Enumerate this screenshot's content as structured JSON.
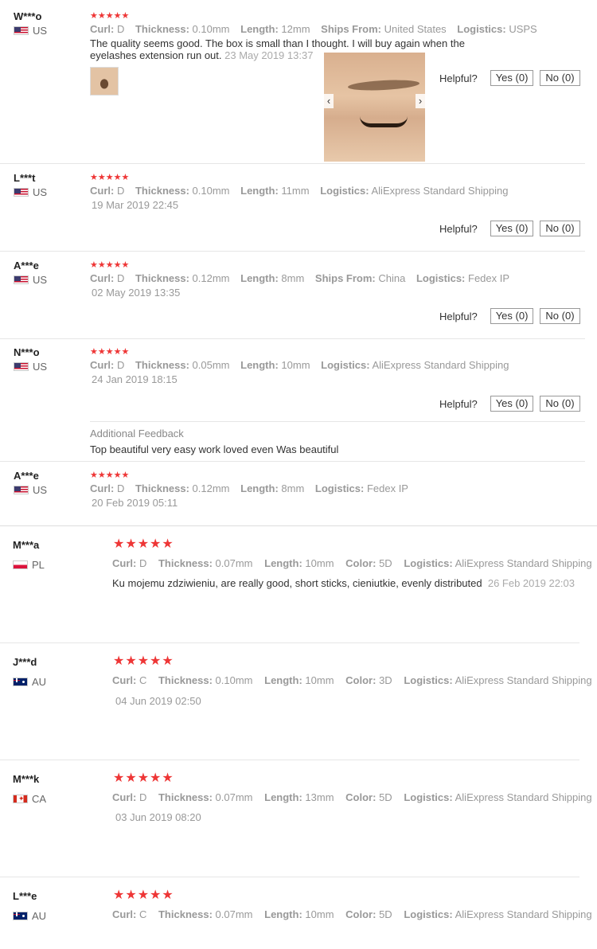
{
  "helpful_label": "Helpful?",
  "additional_feedback_label": "Additional Feedback",
  "reviews": [
    {
      "user": "W***o",
      "country": "US",
      "attrs": {
        "curl_k": "Curl:",
        "curl": "D",
        "thick_k": "Thickness:",
        "thick": "0.10mm",
        "len_k": "Length:",
        "len": "12mm",
        "ships_k": "Ships From:",
        "ships": "United States",
        "log_k": "Logistics:",
        "log": "USPS"
      },
      "text": "The quality seems good. The box is small than I thought. I will buy again when the eyelashes extension run out.",
      "date": "23 May 2019 13:37",
      "yes": "Yes (0)",
      "no": "No (0)"
    },
    {
      "user": "L***t",
      "country": "US",
      "attrs": {
        "curl_k": "Curl:",
        "curl": "D",
        "thick_k": "Thickness:",
        "thick": "0.10mm",
        "len_k": "Length:",
        "len": "11mm",
        "log_k": "Logistics:",
        "log": "AliExpress Standard Shipping"
      },
      "date": "19 Mar 2019 22:45",
      "yes": "Yes (0)",
      "no": "No (0)"
    },
    {
      "user": "A***e",
      "country": "US",
      "attrs": {
        "curl_k": "Curl:",
        "curl": "D",
        "thick_k": "Thickness:",
        "thick": "0.12mm",
        "len_k": "Length:",
        "len": "8mm",
        "ships_k": "Ships From:",
        "ships": "China",
        "log_k": "Logistics:",
        "log": "Fedex IP"
      },
      "date": "02 May 2019 13:35",
      "yes": "Yes (0)",
      "no": "No (0)"
    },
    {
      "user": "N***o",
      "country": "US",
      "attrs": {
        "curl_k": "Curl:",
        "curl": "D",
        "thick_k": "Thickness:",
        "thick": "0.05mm",
        "len_k": "Length:",
        "len": "10mm",
        "log_k": "Logistics:",
        "log": "AliExpress Standard Shipping"
      },
      "date": "24 Jan 2019 18:15",
      "yes": "Yes (0)",
      "no": "No (0)",
      "additional": "Top beautiful very easy work loved even Was beautiful"
    },
    {
      "user": "A***e",
      "country": "US",
      "attrs": {
        "curl_k": "Curl:",
        "curl": "D",
        "thick_k": "Thickness:",
        "thick": "0.12mm",
        "len_k": "Length:",
        "len": "8mm",
        "log_k": "Logistics:",
        "log": "Fedex IP"
      },
      "date": "20 Feb 2019 05:11"
    },
    {
      "user": "M***a",
      "country": "PL",
      "attrs": {
        "curl_k": "Curl:",
        "curl": "D",
        "thick_k": "Thickness:",
        "thick": "0.07mm",
        "len_k": "Length:",
        "len": "10mm",
        "color_k": "Color:",
        "color": "5D",
        "log_k": "Logistics:",
        "log": "AliExpress Standard Shipping"
      },
      "text": "Ku mojemu zdziwieniu, are really good, short sticks, cieniutkie, evenly distributed",
      "date": "26 Feb 2019 22:03"
    },
    {
      "user": "J***d",
      "country": "AU",
      "attrs": {
        "curl_k": "Curl:",
        "curl": "C",
        "thick_k": "Thickness:",
        "thick": "0.10mm",
        "len_k": "Length:",
        "len": "10mm",
        "color_k": "Color:",
        "color": "3D",
        "log_k": "Logistics:",
        "log": "AliExpress Standard Shipping"
      },
      "date": "04 Jun 2019 02:50"
    },
    {
      "user": "M***k",
      "country": "CA",
      "attrs": {
        "curl_k": "Curl:",
        "curl": "D",
        "thick_k": "Thickness:",
        "thick": "0.07mm",
        "len_k": "Length:",
        "len": "13mm",
        "color_k": "Color:",
        "color": "5D",
        "log_k": "Logistics:",
        "log": "AliExpress Standard Shipping"
      },
      "date": "03 Jun 2019 08:20"
    },
    {
      "user": "L***e",
      "country": "AU",
      "attrs": {
        "curl_k": "Curl:",
        "curl": "C",
        "thick_k": "Thickness:",
        "thick": "0.07mm",
        "len_k": "Length:",
        "len": "10mm",
        "color_k": "Color:",
        "color": "5D",
        "log_k": "Logistics:",
        "log": "AliExpress Standard Shipping"
      }
    }
  ],
  "stars": "★★★★★",
  "star_color": "#ee3636",
  "image_nav": {
    "prev": "‹",
    "next": "›"
  }
}
